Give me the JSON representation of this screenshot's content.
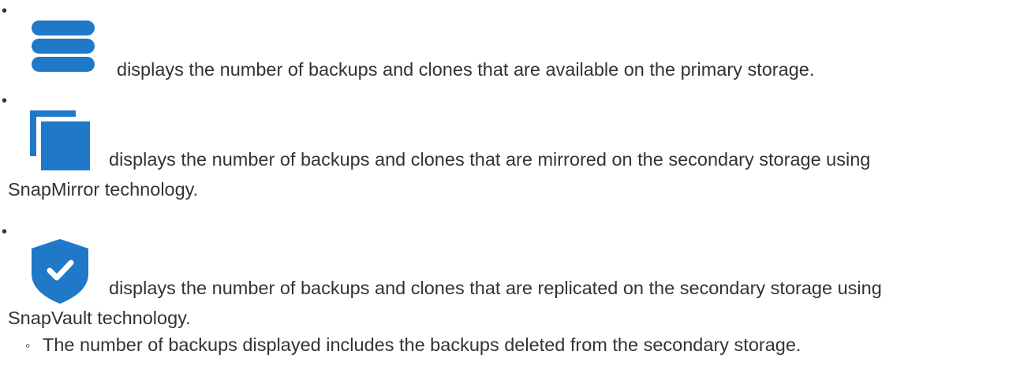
{
  "list": {
    "items": [
      {
        "icon": "database-icon",
        "line1": "displays the number of backups and clones that are available on the primary storage."
      },
      {
        "icon": "copy-stack-icon",
        "line1": "displays the number of backups and clones that are mirrored on the secondary storage using",
        "line2": "SnapMirror technology."
      },
      {
        "icon": "shield-check-icon",
        "line1": "displays the number of backups and clones that are replicated on the secondary storage using",
        "line2": "SnapVault technology."
      }
    ],
    "sub_items": [
      "The number of backups displayed includes the backups deleted from the secondary storage."
    ]
  },
  "colors": {
    "icon_blue": "#1f78c8",
    "text": "#333333"
  }
}
